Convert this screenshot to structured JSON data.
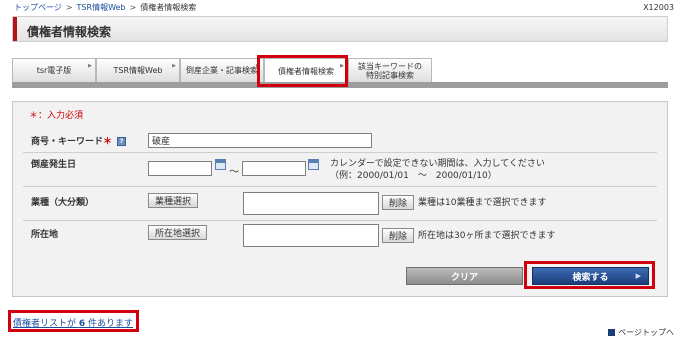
{
  "breadcrumb": {
    "items": [
      "トップページ",
      "TSR情報Web",
      "債権者情報検索"
    ],
    "separator": ">"
  },
  "page_code": "X12003",
  "page_title": "債権者情報検索",
  "tabs": [
    {
      "label": "tsr電子版"
    },
    {
      "label": "TSR情報Web"
    },
    {
      "label": "倒産企業・記事検索"
    },
    {
      "label": "債権者情報検索"
    },
    {
      "label_line1": "該当キーワードの",
      "label_line2": "特別記事検索"
    }
  ],
  "form": {
    "required_note": "＊：入力必須",
    "company_keyword": {
      "label": "商号・キーワード",
      "required_mark": "＊",
      "value": "破産"
    },
    "bankruptcy_date": {
      "label": "倒産発生日",
      "from_value": "",
      "to_value": "",
      "separator": "～",
      "note_line1": "カレンダーで設定できない期間は、入力してください",
      "note_line2": "（例：2000/01/01　～　2000/01/10）"
    },
    "industry": {
      "label": "業種（大分類）",
      "select_button": "業種選択",
      "delete_button": "削除",
      "note": "業種は10業種まで選択できます"
    },
    "location": {
      "label": "所在地",
      "select_button": "所在地選択",
      "delete_button": "削除",
      "note": "所在地は30ヶ所まで選択できます"
    },
    "clear_button": "クリア",
    "search_button": "検索する"
  },
  "result": {
    "prefix": "債権者リストが",
    "count": "6",
    "suffix": "件あります"
  },
  "page_top_link": "ページトップへ",
  "colors": {
    "highlight": "#d0000f",
    "accent": "#b5121b",
    "link": "#1a4fa0",
    "search_button": "#1b3d7a"
  }
}
